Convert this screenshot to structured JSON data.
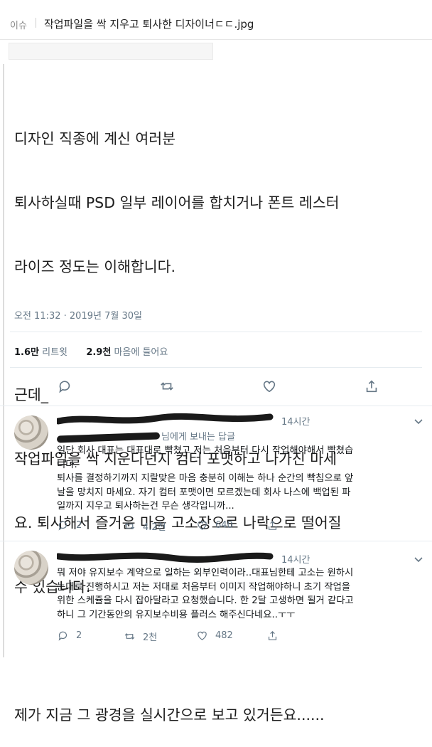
{
  "header": {
    "category": "이슈",
    "title": "작업파일을 싹 지우고 퇴사한 디자이너ㄷㄷ.jpg"
  },
  "tweet": {
    "lines": [
      "디자인 직종에 계신 여러분",
      "퇴사하실때  PSD 일부 레이어를 합치거나 폰트 레스터",
      "라이즈 정도는 이해합니다.",
      "",
      "근데_",
      "작업파일을 싹 지운다던지 컴터 포맷하고 나가진 마세",
      "요. 퇴사해서 즐거운 마음 고소장으로 나락으로 떨어질",
      "수 있습니다.",
      "",
      "제가 지금 그 광경을 실시간으로 보고 있거든요......"
    ],
    "timestamp": "오전 11:32 · 2019년 7월 30일",
    "retweet_count": "1.6만",
    "retweet_label": "리트윗",
    "like_count": "2.9천",
    "like_label": "마음에 들어요"
  },
  "replies": [
    {
      "time": "14시간",
      "replying_to": "님에게 보내는 답글",
      "lines": [
        "일단 회사 대표는 대표대로 빡쳤고 저는 처음부터 다시 작업해야해서 빡쳤습",
        "니다.",
        "퇴사를 결정하기까지 지랄맞은 마음 충분히 이해는 하나 순간의 빡침으로 앞",
        "날을 망치지 마세요. 자기 컴터 포맷이면 모르겠는데 회사 나스에 백업된 파",
        "일까지 지우고 퇴사하는건 무슨 생각입니까..."
      ],
      "reply_count": "2",
      "retweet_count": "4.2천",
      "like_count": "640"
    },
    {
      "time": "14시간",
      "lines": [
        "뭐 저야 유지보수 계약으로 일하는 외부인력이라..대표님한테 고소는 원하시",
        "는대로 진행하시고 저는 저대로 처음부터 이미지 작업해야하니 초기 작업을",
        "위한 스케쥴을 다시 잡아달라고 요청했습니다. 한 2달 고생하면 될거 같다고",
        "하니 그 기간동안의 유지보수비용 플러스 해주신다네요..ㅜㅜ"
      ],
      "reply_count": "2",
      "retweet_count": "2천",
      "like_count": "482"
    }
  ]
}
